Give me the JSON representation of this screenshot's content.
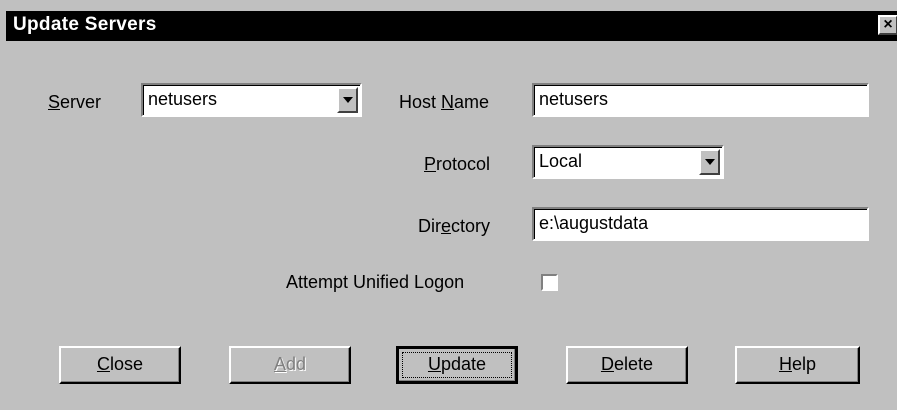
{
  "window": {
    "title": "Update Servers",
    "close_glyph": "×"
  },
  "form": {
    "server": {
      "label_accel": "S",
      "label_rest": "erver",
      "value": "netusers"
    },
    "host_name": {
      "label_pre": "Host ",
      "label_accel": "N",
      "label_rest": "ame",
      "value": "netusers"
    },
    "protocol": {
      "label_accel": "P",
      "label_rest": "rotocol",
      "value": "Local"
    },
    "directory": {
      "label_pre": "Dir",
      "label_accel": "e",
      "label_rest": "ctory",
      "value": "e:\\augustdata"
    },
    "unified_logon": {
      "label": "Attempt Unified Logon",
      "checked": false
    }
  },
  "buttons": {
    "close": {
      "accel": "C",
      "rest": "lose"
    },
    "add": {
      "accel": "A",
      "rest": "dd"
    },
    "update": {
      "accel": "U",
      "rest": "pdate"
    },
    "delete": {
      "accel": "D",
      "rest": "elete"
    },
    "help": {
      "accel": "H",
      "rest": "elp"
    }
  },
  "icons": {
    "dropdown": "chevron-down-icon",
    "close": "close-icon"
  },
  "colors": {
    "face": "#c0c0c0",
    "titlebar": "#000000",
    "disabled_text": "#808080"
  }
}
